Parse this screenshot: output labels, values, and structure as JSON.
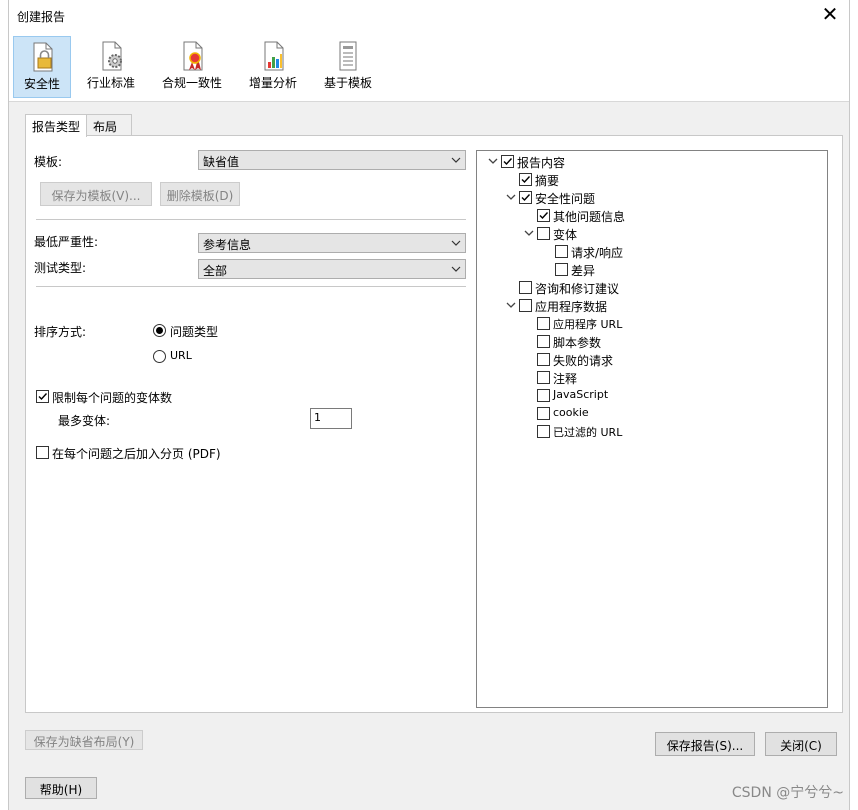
{
  "window": {
    "title": "创建报告"
  },
  "toolbar": {
    "items": [
      {
        "label": "安全性",
        "icon": "lock-document-icon",
        "active": true
      },
      {
        "label": "行业标准",
        "icon": "gear-document-icon",
        "active": false
      },
      {
        "label": "合规一致性",
        "icon": "ribbon-document-icon",
        "active": false
      },
      {
        "label": "增量分析",
        "icon": "chart-document-icon",
        "active": false
      },
      {
        "label": "基于模板",
        "icon": "template-document-icon",
        "active": false
      }
    ]
  },
  "tabs": [
    {
      "label": "报告类型",
      "active": true
    },
    {
      "label": "布局",
      "active": false
    }
  ],
  "form": {
    "template_label": "模板:",
    "template_value": "缺省值",
    "save_template_label": "保存为模板(V)...",
    "delete_template_label": "删除模板(D)",
    "min_severity_label": "最低严重性:",
    "min_severity_value": "参考信息",
    "test_type_label": "测试类型:",
    "test_type_value": "全部",
    "sort_label": "排序方式:",
    "sort_options": [
      {
        "label": "问题类型",
        "selected": true
      },
      {
        "label": "URL",
        "selected": false
      }
    ],
    "limit_variants_label": "限制每个问题的变体数",
    "limit_variants_checked": true,
    "max_variants_label": "最多变体:",
    "max_variants_value": "1",
    "page_break_label": "在每个问题之后加入分页 (PDF)",
    "page_break_checked": false
  },
  "tree": [
    {
      "label": "报告内容",
      "checked": true,
      "expander": "expanded"
    },
    {
      "label": "摘要",
      "checked": true,
      "expander": "none"
    },
    {
      "label": "安全性问题",
      "checked": true,
      "expander": "expanded"
    },
    {
      "label": "其他问题信息",
      "checked": true,
      "expander": "none"
    },
    {
      "label": "变体",
      "checked": false,
      "expander": "expanded"
    },
    {
      "label": "请求/响应",
      "checked": false,
      "expander": "none"
    },
    {
      "label": "差异",
      "checked": false,
      "expander": "none"
    },
    {
      "label": "咨询和修订建议",
      "checked": false,
      "expander": "none"
    },
    {
      "label": "应用程序数据",
      "checked": false,
      "expander": "expanded"
    },
    {
      "label": "应用程序 URL",
      "checked": false,
      "expander": "none"
    },
    {
      "label": "脚本参数",
      "checked": false,
      "expander": "none"
    },
    {
      "label": "失败的请求",
      "checked": false,
      "expander": "none"
    },
    {
      "label": "注释",
      "checked": false,
      "expander": "none"
    },
    {
      "label": "JavaScript",
      "checked": false,
      "expander": "none"
    },
    {
      "label": "cookie",
      "checked": false,
      "expander": "none"
    },
    {
      "label": "已过滤的 URL",
      "checked": false,
      "expander": "none"
    }
  ],
  "buttons": {
    "save_default_layout": "保存为缺省布局(Y)",
    "save_report": "保存报告(S)...",
    "close": "关闭(C)",
    "help": "帮助(H)"
  },
  "watermark": "CSDN @宁兮兮~"
}
